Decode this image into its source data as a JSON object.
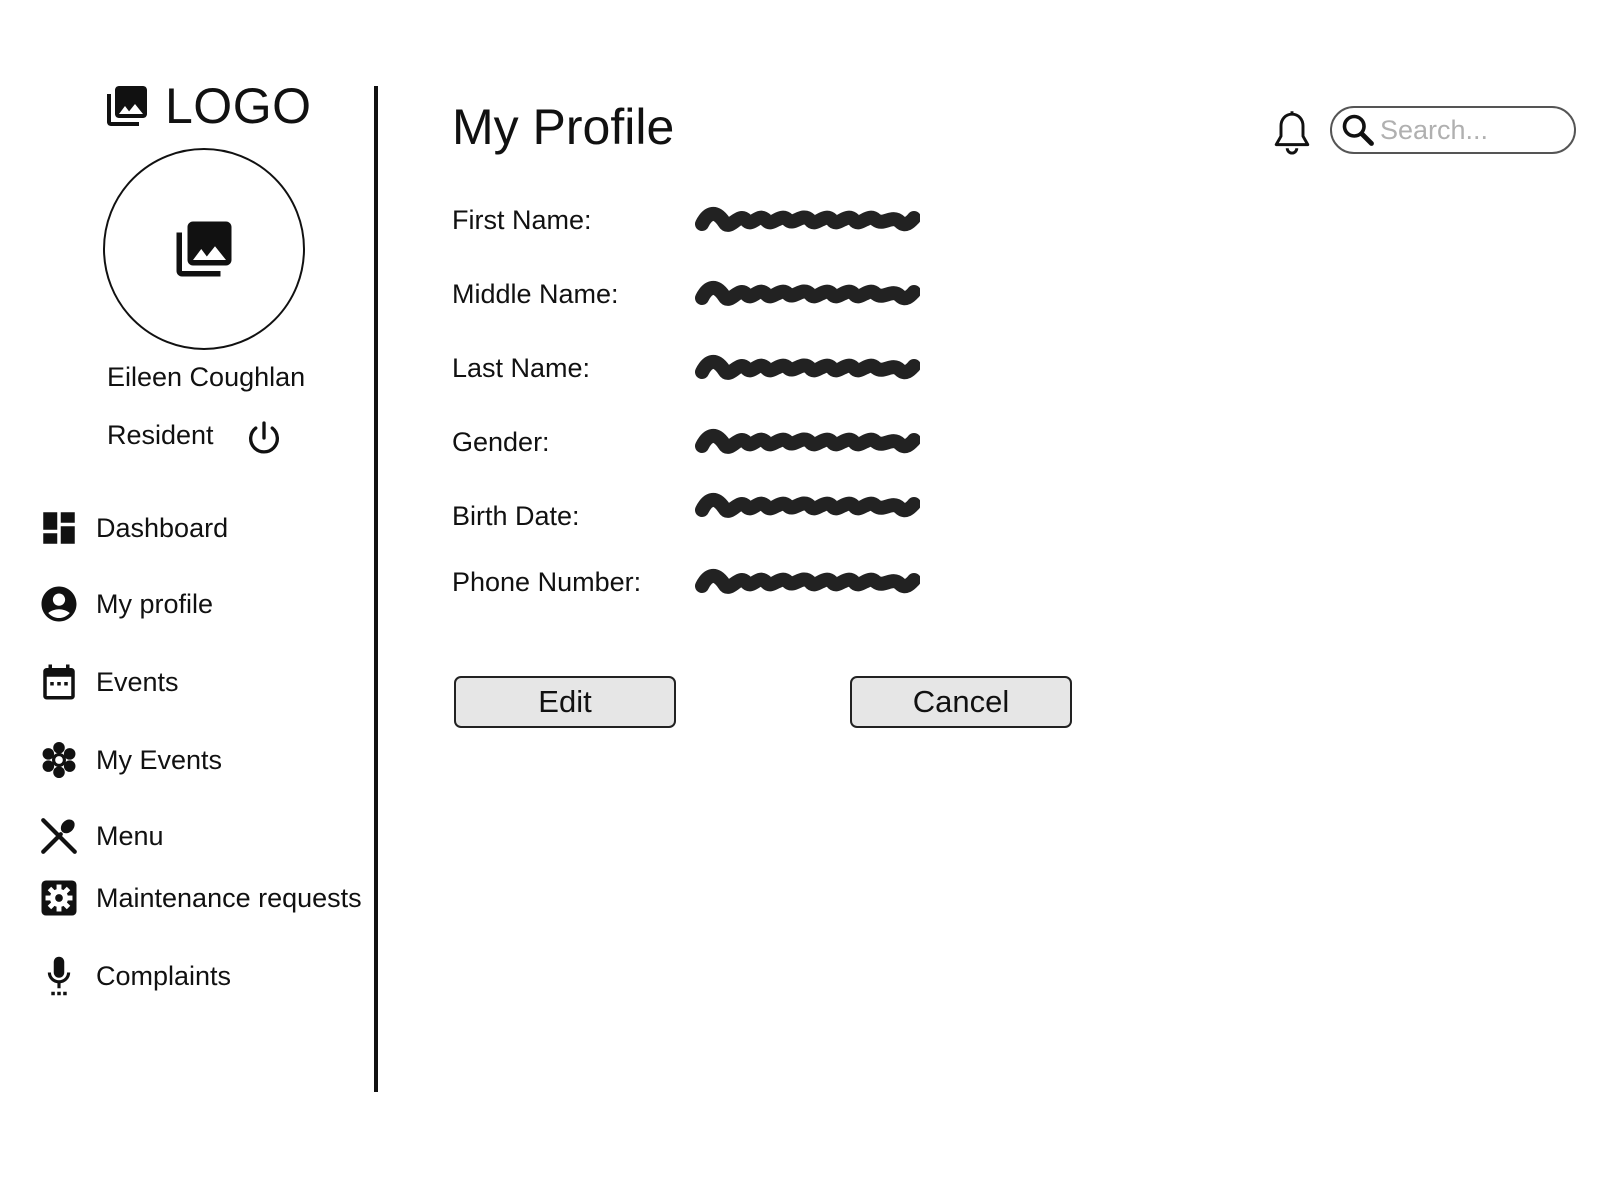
{
  "brand": {
    "logo_text": "LOGO",
    "logo_icon": "photo-library-icon"
  },
  "user": {
    "name": "Eileen Coughlan",
    "role": "Resident",
    "avatar_icon": "photo-library-icon"
  },
  "sidebar": {
    "items": [
      {
        "label": "Dashboard",
        "icon": "dashboard-icon"
      },
      {
        "label": "My profile",
        "icon": "account-circle-icon"
      },
      {
        "label": "Events",
        "icon": "calendar-icon"
      },
      {
        "label": "My Events",
        "icon": "flower-icon"
      },
      {
        "label": "Menu",
        "icon": "utensils-icon"
      },
      {
        "label": "Maintenance requests",
        "icon": "settings-box-icon"
      },
      {
        "label": "Complaints",
        "icon": "microphone-icon"
      }
    ]
  },
  "header": {
    "title": "My Profile",
    "notification_icon": "bell-icon",
    "search": {
      "placeholder": "Search...",
      "value": ""
    }
  },
  "profile": {
    "fields": [
      {
        "label": "First Name:",
        "value": "redacted-scribble"
      },
      {
        "label": "Middle Name:",
        "value": "redacted-scribble"
      },
      {
        "label": "Last Name:",
        "value": "redacted-scribble"
      },
      {
        "label": "Gender:",
        "value": "redacted-scribble"
      },
      {
        "label": "Birth Date:",
        "value": "redacted-scribble"
      },
      {
        "label": "Phone Number:",
        "value": "redacted-scribble"
      }
    ]
  },
  "actions": {
    "edit_label": "Edit",
    "cancel_label": "Cancel"
  },
  "colors": {
    "text": "#111111",
    "button_bg": "#e6e6e6",
    "placeholder": "#b0b0b0"
  }
}
